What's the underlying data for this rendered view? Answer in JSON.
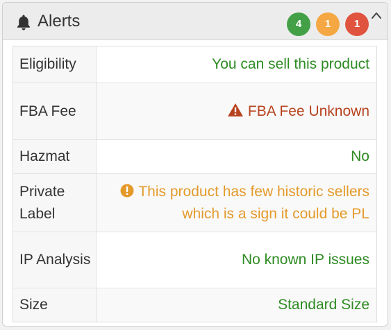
{
  "header": {
    "title": "Alerts",
    "icon": "bell-icon",
    "badges": [
      {
        "count": "4",
        "color": "#43a047"
      },
      {
        "count": "1",
        "color": "#f4a742"
      },
      {
        "count": "1",
        "color": "#e0533f"
      }
    ],
    "collapse_icon": "chevron-up-icon"
  },
  "colors": {
    "ok": "#2e8b23",
    "warning": "#e49a2b",
    "danger": "#b8431f"
  },
  "rows": [
    {
      "label": "Eligibility",
      "value": "You can sell this product",
      "status": "ok"
    },
    {
      "label": "FBA Fee",
      "value": "FBA Fee Unknown",
      "status": "danger",
      "icon": "warning-triangle-icon"
    },
    {
      "label": "Hazmat",
      "value": "No",
      "status": "ok"
    },
    {
      "label": "Private Label",
      "value": "This product has few historic sellers which is a sign it could be PL",
      "status": "warning",
      "icon": "exclamation-circle-icon"
    },
    {
      "label": "IP Analysis",
      "value": "No known IP issues",
      "status": "ok"
    },
    {
      "label": "Size",
      "value": "Standard Size",
      "status": "ok"
    }
  ]
}
